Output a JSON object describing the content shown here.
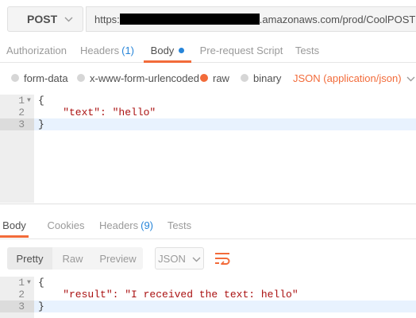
{
  "request": {
    "method": "POST",
    "url_prefix": "https:",
    "url_suffix": ".amazonaws.com/prod/CoolPOST"
  },
  "request_tabs": [
    {
      "label": "Authorization",
      "active": false
    },
    {
      "label": "Headers",
      "count": "(1)",
      "active": false
    },
    {
      "label": "Body",
      "active": true,
      "modified": true
    },
    {
      "label": "Pre-request Script",
      "active": false
    },
    {
      "label": "Tests",
      "active": false
    }
  ],
  "body_types": {
    "options": [
      "form-data",
      "x-www-form-urlencoded",
      "raw",
      "binary"
    ],
    "selected": "raw",
    "content_type": "JSON (application/json)"
  },
  "request_body": {
    "lines": [
      {
        "num": "1",
        "text": "{"
      },
      {
        "num": "2",
        "text": "    \"text\": \"hello\""
      },
      {
        "num": "3",
        "text": "}"
      }
    ]
  },
  "response_tabs": [
    {
      "label": "Body",
      "active": true
    },
    {
      "label": "Cookies",
      "active": false
    },
    {
      "label": "Headers",
      "count": "(9)",
      "active": false
    },
    {
      "label": "Tests",
      "active": false
    }
  ],
  "response_view": {
    "modes": [
      "Pretty",
      "Raw",
      "Preview"
    ],
    "selected": "Pretty",
    "format": "JSON",
    "wrap_icon": "wrap-lines-icon"
  },
  "response_body": {
    "lines": [
      {
        "num": "1",
        "text": "{"
      },
      {
        "num": "2",
        "text": "    \"result\": \"I received the text: hello\""
      },
      {
        "num": "3",
        "text": "}"
      }
    ]
  },
  "colors": {
    "accent": "#f26b3a",
    "link": "#2785d9",
    "json_string": "#aa1111"
  }
}
